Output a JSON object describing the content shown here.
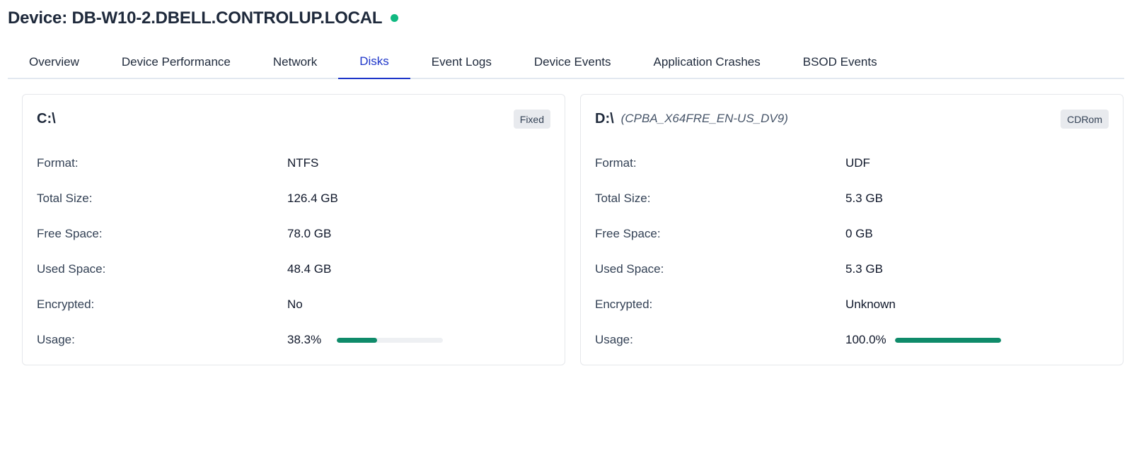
{
  "header": {
    "title": "Device: DB-W10-2.DBELL.CONTROLUP.LOCAL",
    "status_color": "#10b981"
  },
  "tabs": [
    {
      "label": "Overview",
      "active": false
    },
    {
      "label": "Device Performance",
      "active": false
    },
    {
      "label": "Network",
      "active": false
    },
    {
      "label": "Disks",
      "active": true
    },
    {
      "label": "Event Logs",
      "active": false
    },
    {
      "label": "Device Events",
      "active": false
    },
    {
      "label": "Application Crashes",
      "active": false
    },
    {
      "label": "BSOD Events",
      "active": false
    }
  ],
  "labels": {
    "format": "Format:",
    "total_size": "Total Size:",
    "free_space": "Free Space:",
    "used_space": "Used Space:",
    "encrypted": "Encrypted:",
    "usage": "Usage:"
  },
  "disks": [
    {
      "drive": "C:\\",
      "volume_label": "",
      "type": "Fixed",
      "format": "NTFS",
      "total_size": "126.4 GB",
      "free_space": "78.0 GB",
      "used_space": "48.4 GB",
      "encrypted": "No",
      "usage_text": "38.3%",
      "usage_fraction": 0.383
    },
    {
      "drive": "D:\\",
      "volume_label": "(CPBA_X64FRE_EN-US_DV9)",
      "type": "CDRom",
      "format": "UDF",
      "total_size": "5.3 GB",
      "free_space": "0 GB",
      "used_space": "5.3 GB",
      "encrypted": "Unknown",
      "usage_text": "100.0%",
      "usage_fraction": 1.0
    }
  ],
  "colors": {
    "accent": "#1d35c9",
    "usage_bar": "#0f8b6a"
  }
}
